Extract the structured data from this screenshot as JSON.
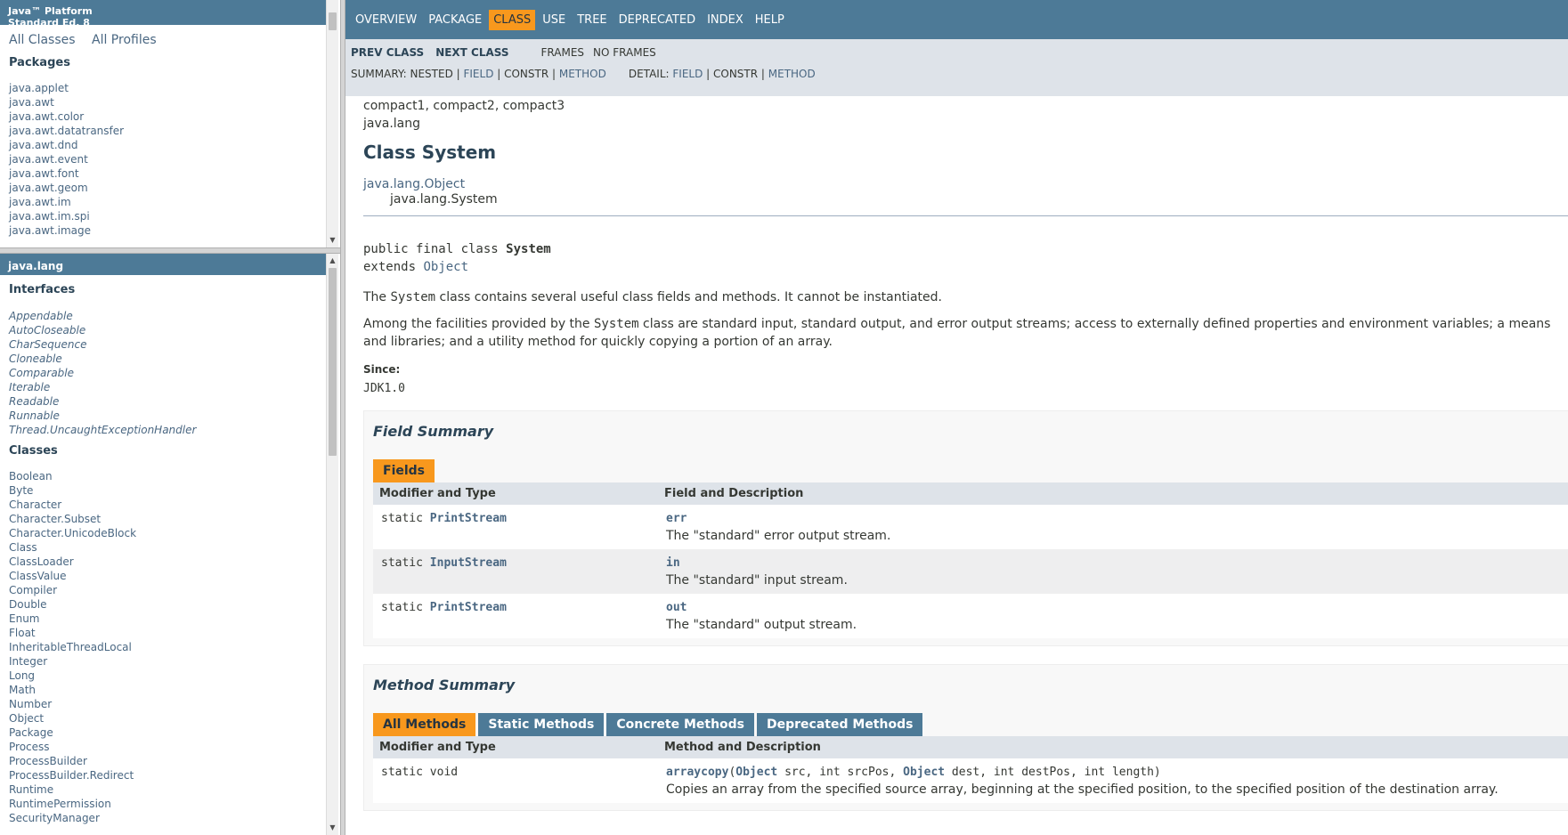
{
  "left": {
    "platform_title_line1": "Java™ Platform",
    "platform_title_line2": "Standard Ed. 8",
    "all_classes": "All Classes",
    "all_profiles": "All Profiles",
    "packages_heading": "Packages",
    "packages": [
      "java.applet",
      "java.awt",
      "java.awt.color",
      "java.awt.datatransfer",
      "java.awt.dnd",
      "java.awt.event",
      "java.awt.font",
      "java.awt.geom",
      "java.awt.im",
      "java.awt.im.spi",
      "java.awt.image"
    ],
    "package_name": "java.lang",
    "interfaces_heading": "Interfaces",
    "interfaces": [
      "Appendable",
      "AutoCloseable",
      "CharSequence",
      "Cloneable",
      "Comparable",
      "Iterable",
      "Readable",
      "Runnable",
      "Thread.UncaughtExceptionHandler"
    ],
    "classes_heading": "Classes",
    "classes": [
      "Boolean",
      "Byte",
      "Character",
      "Character.Subset",
      "Character.UnicodeBlock",
      "Class",
      "ClassLoader",
      "ClassValue",
      "Compiler",
      "Double",
      "Enum",
      "Float",
      "InheritableThreadLocal",
      "Integer",
      "Long",
      "Math",
      "Number",
      "Object",
      "Package",
      "Process",
      "ProcessBuilder",
      "ProcessBuilder.Redirect",
      "Runtime",
      "RuntimePermission",
      "SecurityManager"
    ]
  },
  "nav": {
    "items": [
      "OVERVIEW",
      "PACKAGE",
      "CLASS",
      "USE",
      "TREE",
      "DEPRECATED",
      "INDEX",
      "HELP"
    ],
    "active": "CLASS",
    "prev_class": "PREV CLASS",
    "next_class": "NEXT CLASS",
    "frames": "FRAMES",
    "no_frames": "NO FRAMES",
    "summary_label": "SUMMARY: NESTED | ",
    "summary_field": "FIELD",
    "sep": " | ",
    "summary_constr": "CONSTR",
    "summary_method": "METHOD",
    "detail_label": "DETAIL: ",
    "detail_field": "FIELD",
    "detail_constr": "CONSTR",
    "detail_method": "METHOD"
  },
  "main": {
    "profiles": "compact1, compact2, compact3",
    "package": "java.lang",
    "class_title": "Class System",
    "inherit_parent": "java.lang.Object",
    "inherit_child": "java.lang.System",
    "sig_prefix": "public final class ",
    "sig_name": "System",
    "sig_extends": "extends ",
    "sig_extends_link": "Object",
    "desc1_pre": "The ",
    "desc1_code": "System",
    "desc1_post": " class contains several useful class fields and methods. It cannot be instantiated.",
    "desc2_pre": "Among the facilities provided by the ",
    "desc2_code": "System",
    "desc2_post": " class are standard input, standard output, and error output streams; access to externally defined properties and environment variables; a means",
    "desc2_line2": "and libraries; and a utility method for quickly copying a portion of an array.",
    "since_label": "Since:",
    "since_value": "JDK1.0"
  },
  "field_summary": {
    "heading": "Field Summary",
    "tab": "Fields",
    "col1": "Modifier and Type",
    "col2": "Field and Description",
    "rows": [
      {
        "mod": "static ",
        "type": "PrintStream",
        "name": "err",
        "desc": "The \"standard\" error output stream."
      },
      {
        "mod": "static ",
        "type": "InputStream",
        "name": "in",
        "desc": "The \"standard\" input stream."
      },
      {
        "mod": "static ",
        "type": "PrintStream",
        "name": "out",
        "desc": "The \"standard\" output stream."
      }
    ]
  },
  "method_summary": {
    "heading": "Method Summary",
    "tabs": [
      "All Methods",
      "Static Methods",
      "Concrete Methods",
      "Deprecated Methods"
    ],
    "active_tab": "All Methods",
    "col1": "Modifier and Type",
    "col2": "Method and Description",
    "rows": [
      {
        "mod": "static void",
        "name": "arraycopy",
        "p1_type": "Object",
        "p1_name": " src, ",
        "p2": "int srcPos, ",
        "p3_type": "Object",
        "p3_name": " dest, ",
        "p4": "int destPos, int length)",
        "desc": "Copies an array from the specified source array, beginning at the specified position, to the specified position of the destination array."
      }
    ]
  },
  "colors": {
    "nav_bg": "#4d7a97",
    "active_tab": "#f8981d",
    "subnav_bg": "#dee3e9",
    "link": "#4a6782"
  }
}
